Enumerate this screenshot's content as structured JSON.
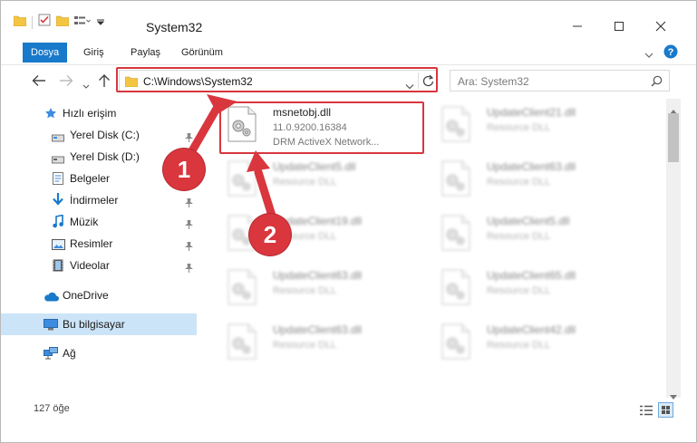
{
  "window": {
    "title": "System32"
  },
  "ribbon": {
    "tabs": [
      "Dosya",
      "Giriş",
      "Paylaş",
      "Görünüm"
    ]
  },
  "navigation": {
    "address": "C:\\Windows\\System32",
    "search_placeholder": "Ara: System32"
  },
  "sidebar": {
    "items": [
      {
        "label": "Hızlı erişim",
        "icon": "star-icon"
      },
      {
        "label": "Yerel Disk (C:)",
        "icon": "drive-icon",
        "pinned": true
      },
      {
        "label": "Yerel Disk (D:)",
        "icon": "drive-icon"
      },
      {
        "label": "Belgeler",
        "icon": "documents-icon"
      },
      {
        "label": "İndirmeler",
        "icon": "download-icon",
        "pinned": true
      },
      {
        "label": "Müzik",
        "icon": "music-icon",
        "pinned": true
      },
      {
        "label": "Resimler",
        "icon": "pictures-icon",
        "pinned": true
      },
      {
        "label": "Videolar",
        "icon": "videos-icon",
        "pinned": true
      },
      {
        "label": "OneDrive",
        "icon": "cloud-icon"
      },
      {
        "label": "Bu bilgisayar",
        "icon": "computer-icon",
        "selected": true
      },
      {
        "label": "Ağ",
        "icon": "network-icon"
      }
    ]
  },
  "files": [
    {
      "name": "msnetobj.dll",
      "version": "11.0.9200.16384",
      "description": "DRM ActiveX Network..."
    },
    {
      "name": "UpdateClient21.dll",
      "description": "Resource DLL"
    },
    {
      "name": "UpdateClient5.dll",
      "description": "Resource DLL"
    },
    {
      "name": "UpdateClient63.dll",
      "description": "Resource DLL"
    },
    {
      "name": "UpdateClient19.dll",
      "description": "Resource DLL"
    },
    {
      "name": "UpdateClient5.dll",
      "description": "Resource DLL"
    },
    {
      "name": "UpdateClient63.dll",
      "description": "Resource DLL"
    },
    {
      "name": "UpdateClient65.dll",
      "description": "Resource DLL"
    },
    {
      "name": "UpdateClient63.dll",
      "description": "Resource DLL"
    },
    {
      "name": "UpdateClient42.dll",
      "description": "Resource DLL"
    }
  ],
  "status": {
    "item_count": "127 öğe"
  },
  "annotations": {
    "step1": "1",
    "step2": "2",
    "color": "#d9363e"
  },
  "colors": {
    "accent": "#1979ca",
    "selection": "#cce4f7"
  }
}
